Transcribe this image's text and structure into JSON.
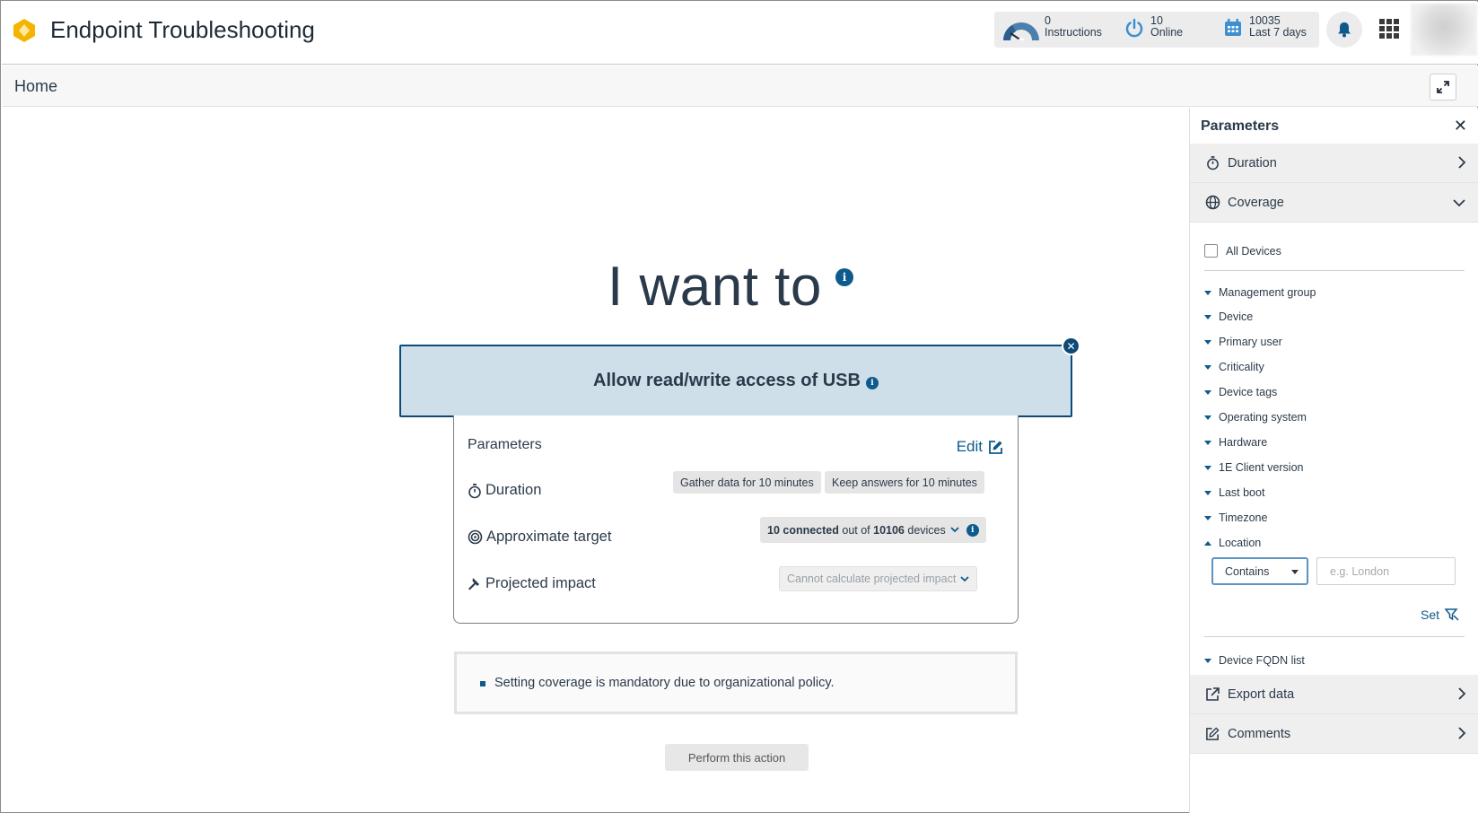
{
  "app": {
    "title": "Endpoint Troubleshooting"
  },
  "stats": [
    {
      "value": "0",
      "label": "Instructions",
      "icon": "gauge-icon"
    },
    {
      "value": "10",
      "label": "Online",
      "icon": "power-icon"
    },
    {
      "value": "10035",
      "label": "Last 7 days",
      "icon": "calendar-icon"
    }
  ],
  "breadcrumb": {
    "home": "Home"
  },
  "main": {
    "headline": "I want to",
    "action_title": "Allow read/write access of USB",
    "parameters_title": "Parameters",
    "edit_label": "Edit",
    "rows": {
      "duration_label": "Duration",
      "duration_gather": "Gather data for 10 minutes",
      "duration_keep": "Keep answers for 10 minutes",
      "target_label": "Approximate target",
      "target_connected": "10 connected",
      "target_mid": " out of ",
      "target_total": "10106",
      "target_suffix": " devices",
      "impact_label": "Projected impact",
      "impact_value": "Cannot calculate projected impact"
    },
    "policy_note": "Setting coverage is mandatory due to organizational policy.",
    "perform_button": "Perform this action"
  },
  "panel": {
    "title": "Parameters",
    "duration": "Duration",
    "coverage": "Coverage",
    "all_devices": "All Devices",
    "criteria": [
      "Management group",
      "Device",
      "Primary user",
      "Criticality",
      "Device tags",
      "Operating system",
      "Hardware",
      "1E Client version",
      "Last boot",
      "Timezone",
      "Location"
    ],
    "location_operator": "Contains",
    "location_placeholder": "e.g. London",
    "set_label": "Set",
    "fqdn": "Device FQDN list",
    "export": "Export data",
    "comments": "Comments"
  },
  "colors": {
    "accent": "#0d5a8c",
    "action_bg": "#cfdfe9",
    "action_border": "#0d4a78"
  }
}
